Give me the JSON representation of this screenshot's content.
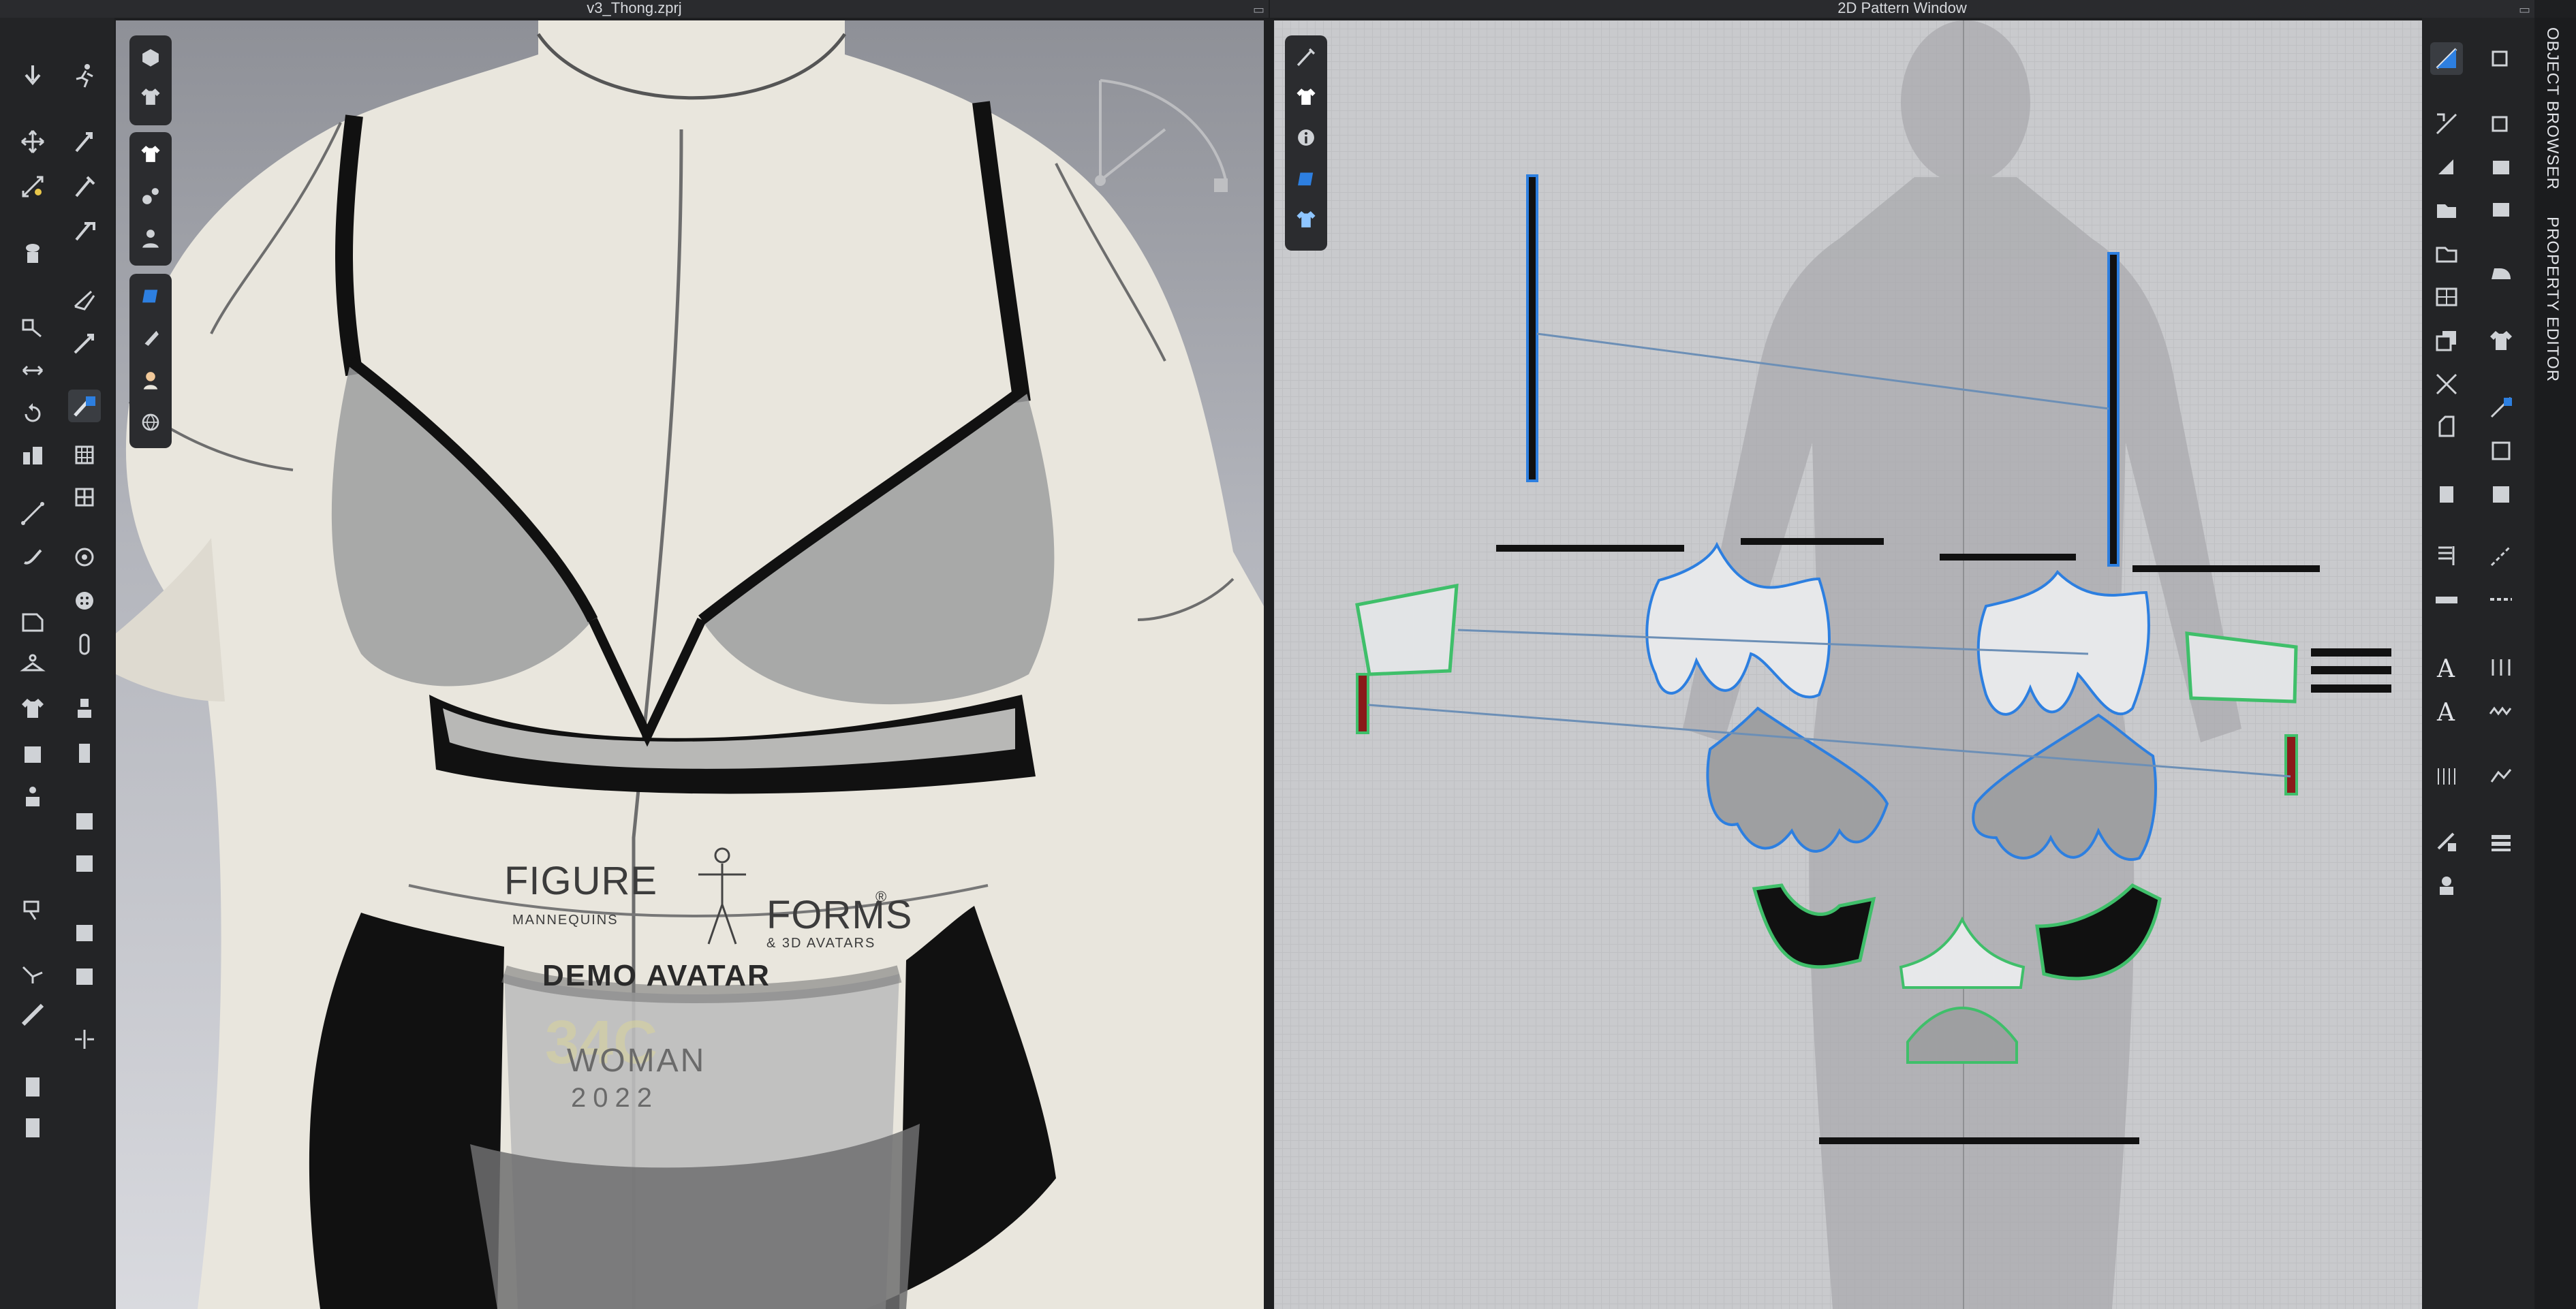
{
  "left_window": {
    "title": "v3_Thong.zprj"
  },
  "right_window": {
    "title": "2D Pattern Window"
  },
  "side_tabs": [
    "OBJECT BROWSER",
    "PROPERTY EDITOR"
  ],
  "avatar_print": {
    "brand_left": "FIGURE",
    "brand_right": "FORMS",
    "trademark": "®",
    "mannequins": "MANNEQUINS",
    "avatars": "& 3D AVATARS",
    "demo": "DEMO AVATAR",
    "woman": "WOMAN",
    "year": "2022",
    "faded_mark": "34C"
  },
  "colors": {
    "accent_blue": "#2d7fe0",
    "pattern_outline": "#3fbf6a",
    "background": "#1e1f21"
  }
}
